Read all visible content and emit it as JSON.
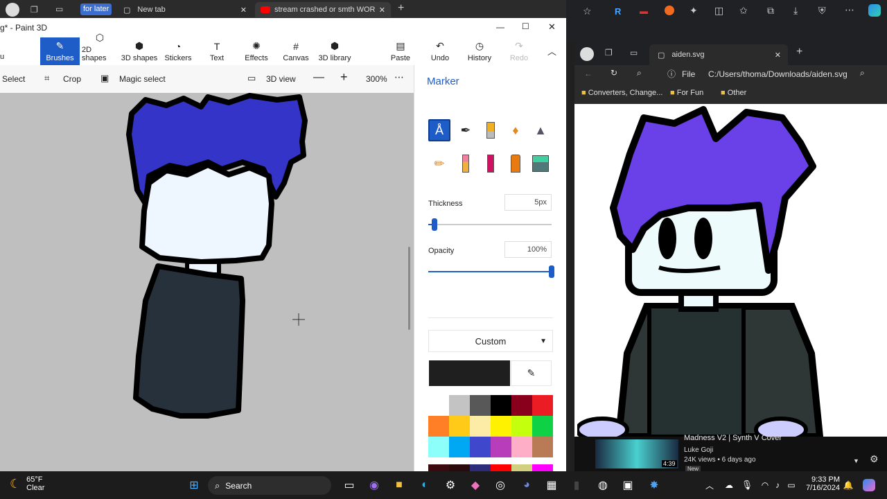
{
  "top_tabs": [
    {
      "label": "for later"
    },
    {
      "label": "New tab"
    },
    {
      "label": "stream crashed or smth WORKIN"
    }
  ],
  "paint": {
    "title": "g* - Paint 3D",
    "ribbon": {
      "brushes": "Brushes",
      "shapes2d": "2D shapes",
      "shapes3d": "3D shapes",
      "stickers": "Stickers",
      "text": "Text",
      "effects": "Effects",
      "canvas": "Canvas",
      "library": "3D library",
      "paste": "Paste",
      "undo": "Undo",
      "history": "History",
      "redo": "Redo"
    },
    "subtool": {
      "select": "Select",
      "crop": "Crop",
      "magic_select": "Magic select",
      "view3d": "3D view",
      "zoom": "300%"
    },
    "panel": {
      "title": "Marker",
      "thickness_label": "Thickness",
      "thickness_value": "5px",
      "thickness_level": 0.05,
      "opacity_label": "Opacity",
      "opacity_value": "100%",
      "opacity_level": 1.0,
      "custom_label": "Custom",
      "current_color": "#1f1f1f",
      "palette": [
        "#ffffff",
        "#c3c3c3",
        "#585858",
        "#000000",
        "#88001b",
        "#ec1c24",
        "#ff7f27",
        "#ffca18",
        "#fdeca6",
        "#fff200",
        "#c4ff0e",
        "#0ed145",
        "#8cfffb",
        "#00a8f3",
        "#3f48cc",
        "#b83dba",
        "#ffaec8",
        "#b97a56"
      ],
      "palette_custom": [
        "#3b0a0f",
        "#2a0a0a",
        "#2c2c7a",
        "#ff0000",
        "#d0d080",
        "#ff00ff"
      ]
    },
    "colors": {
      "hair": "#3434c8",
      "face": "#eef6ff",
      "body": "#27313b",
      "outline": "#000000"
    }
  },
  "edge": {
    "tab_label": "aiden.svg",
    "addr_prefix": "File",
    "url": "C:/Users/thoma/Downloads/aiden.svg",
    "favorites": [
      "Converters, Change...",
      "For Fun",
      "Other"
    ],
    "colors": {
      "hair": "#6a40e8",
      "face": "#eefbfd",
      "body": "#2e3735"
    }
  },
  "youtube": {
    "title": "Madness V2 | Synth V Cover",
    "channel": "Luke Goji",
    "meta": "24K views • 6 days ago",
    "duration": "4:39",
    "badge": "New"
  },
  "taskbar": {
    "temp": "65°F",
    "weather": "Clear",
    "search": "Search",
    "time": "9:33 PM",
    "date": "7/16/2024"
  }
}
